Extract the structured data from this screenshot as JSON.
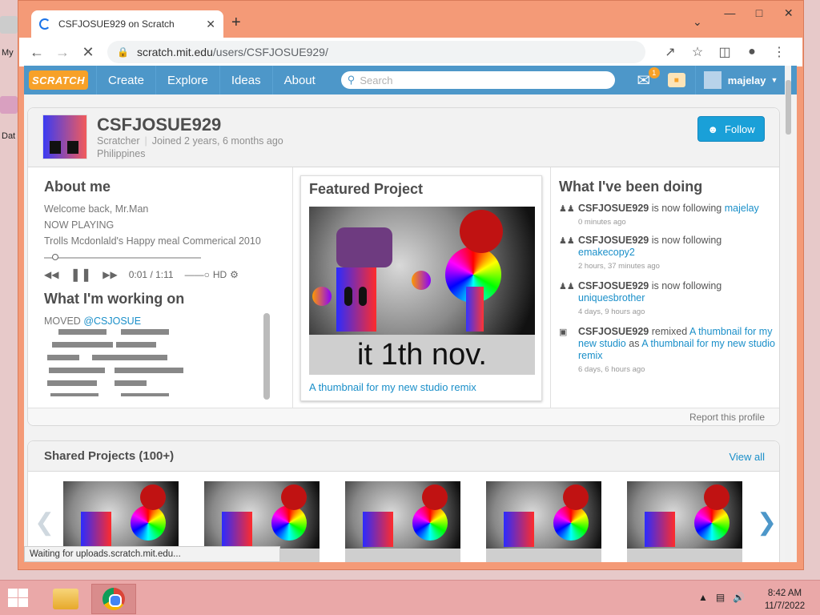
{
  "desktop": {
    "icon_labels": [
      "My",
      "Dat"
    ]
  },
  "browser": {
    "tab_title": "CSFJOSUE929 on Scratch",
    "url_host": "scratch.mit.edu",
    "url_path": "/users/CSFJOSUE929/",
    "status_text": "Waiting for uploads.scratch.mit.edu..."
  },
  "nav": {
    "logo": "SCRATCH",
    "links": [
      "Create",
      "Explore",
      "Ideas",
      "About"
    ],
    "search_placeholder": "Search",
    "message_count": "1",
    "username": "majelay"
  },
  "profile": {
    "username": "CSFJOSUE929",
    "role": "Scratcher",
    "joined": "Joined 2 years, 6 months ago",
    "country": "Philippines",
    "follow_label": "Follow",
    "report_label": "Report this profile"
  },
  "about": {
    "heading": "About me",
    "lines": [
      "Welcome back, Mr.Man",
      "NOW PLAYING",
      "Trolls Mcdonlald's Happy meal Commerical 2010"
    ],
    "player_time": "0:01 / 1:11",
    "player_hd": "HD"
  },
  "working": {
    "heading": "What I'm working on",
    "text_prefix": "MOVED ",
    "mention": "@CSJOSUE"
  },
  "featured": {
    "heading": "Featured Project",
    "thumb_caption": "it 1th nov.",
    "project_title": "A thumbnail for my new studio remix"
  },
  "activity": {
    "heading": "What I've been doing",
    "items": [
      {
        "actor": "CSFJOSUE929",
        "verb": " is now following ",
        "target": "majelay",
        "time": "0 minutes ago"
      },
      {
        "actor": "CSFJOSUE929",
        "verb": " is now following ",
        "target": "emakecopy2",
        "time": "2 hours, 37 minutes ago"
      },
      {
        "actor": "CSFJOSUE929",
        "verb": " is now following ",
        "target": "uniquesbrother",
        "time": "4 days, 9 hours ago"
      },
      {
        "actor": "CSFJOSUE929",
        "verb": " remixed ",
        "target": "A thumbnail for my new studio",
        "verb2": " as ",
        "target2": "A thumbnail for my new studio remix",
        "time": "6 days, 6 hours ago"
      }
    ]
  },
  "shared": {
    "heading": "Shared Projects (100+)",
    "view_all": "View all"
  },
  "taskbar": {
    "time": "8:42 AM",
    "date": "11/7/2022"
  },
  "colors": {
    "window_frame": "#f49a77",
    "scratch_nav": "#4d97c9",
    "follow_button": "#1aa0d8",
    "link": "#1a8fc9"
  }
}
